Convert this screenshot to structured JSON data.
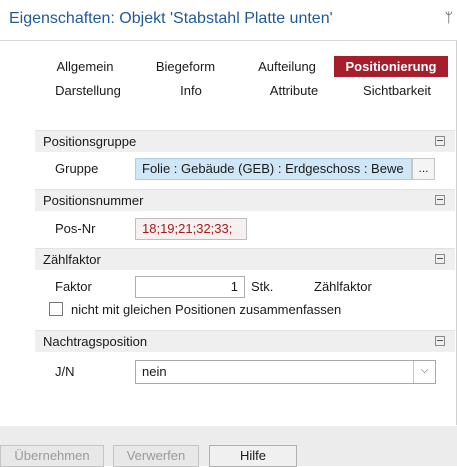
{
  "window": {
    "title": "Eigenschaften: Objekt 'Stabstahl Platte unten'",
    "pin_icon": "pin-icon"
  },
  "tabs": {
    "row1": [
      "Allgemein",
      "Biegeform",
      "Aufteilung",
      "Positionierung"
    ],
    "row2": [
      "Darstellung",
      "Info",
      "Attribute",
      "Sichtbarkeit"
    ],
    "active": "Positionierung",
    "active_color": "#a61e2b"
  },
  "sections": {
    "positionsgruppe": {
      "title": "Positionsgruppe",
      "gruppe_label": "Gruppe",
      "gruppe_value": "Folie : Gebäude (GEB) : Erdgeschoss : Bewe",
      "ellipsis_label": "..."
    },
    "positionsnummer": {
      "title": "Positionsnummer",
      "posnr_label": "Pos-Nr",
      "posnr_value": "18;19;21;32;33;"
    },
    "zaehlfaktor": {
      "title": "Zählfaktor",
      "faktor_label": "Faktor",
      "faktor_value": "1",
      "unit": "Stk.",
      "side_label": "Zählfaktor",
      "checkbox_label": "nicht mit gleichen Positionen zusammenfassen",
      "checkbox_checked": false
    },
    "nachtragsposition": {
      "title": "Nachtragsposition",
      "jn_label": "J/N",
      "jn_value": "nein"
    }
  },
  "buttons": {
    "apply": "Übernehmen",
    "discard": "Verwerfen",
    "help": "Hilfe"
  }
}
